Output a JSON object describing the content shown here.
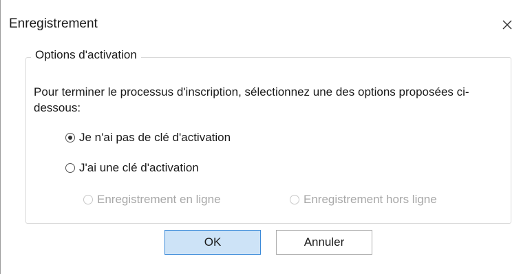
{
  "window": {
    "title": "Enregistrement",
    "close_glyph": "×"
  },
  "group": {
    "legend": "Options d'activation",
    "description": "Pour terminer le processus d'inscription, sélectionnez une des options proposées ci-dessous:"
  },
  "options": {
    "no_key": {
      "label": "Je n'ai pas de clé d'activation",
      "checked": true
    },
    "have_key": {
      "label": "J'ai une clé d'activation",
      "checked": false
    },
    "online": {
      "label": "Enregistrement en ligne",
      "enabled": false
    },
    "offline": {
      "label": "Enregistrement hors ligne",
      "enabled": false
    }
  },
  "buttons": {
    "ok": "OK",
    "cancel": "Annuler"
  },
  "colors": {
    "ok_bg": "#cde3f7",
    "ok_border": "#3b8ad9",
    "disabled_text": "#a8a8a8"
  }
}
